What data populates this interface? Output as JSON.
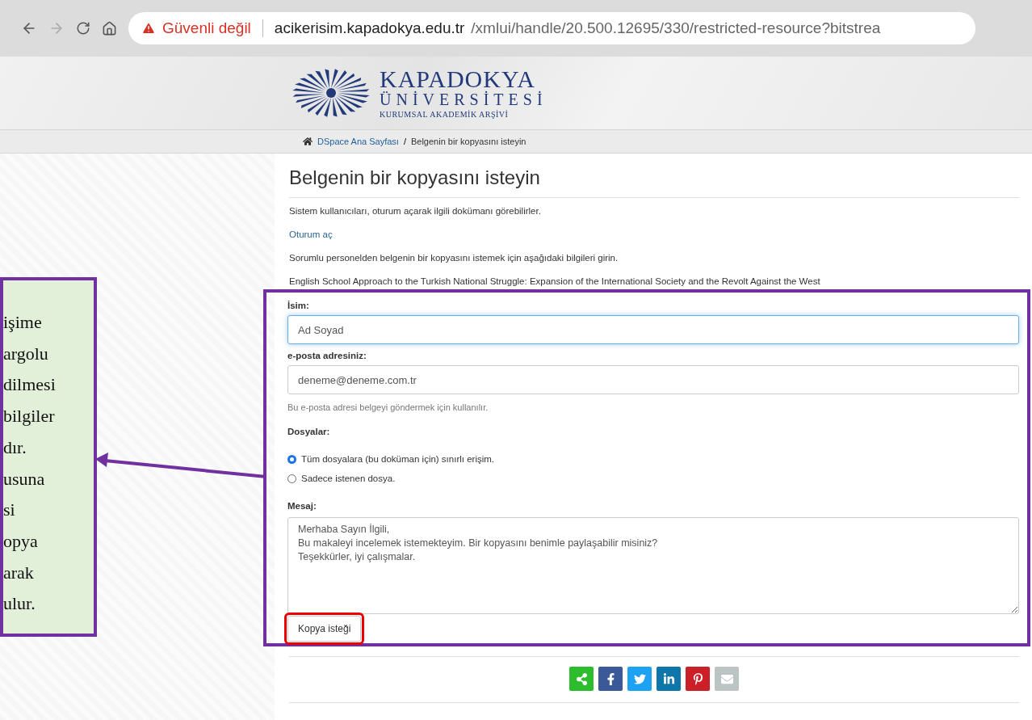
{
  "browser": {
    "security": "Güvenli değil",
    "url_host": "acikerisim.kapadokya.edu.tr",
    "url_path": "/xmlui/handle/20.500.12695/330/restricted-resource?bitstrea"
  },
  "logo": {
    "name": "KAPADOKYA",
    "subtitle": "ÜNİVERSİTESİ",
    "tagline": "KURUMSAL AKADEMİK ARŞİVİ"
  },
  "breadcrumb": [
    {
      "label": "DSpace Ana Sayfası",
      "link": true
    },
    {
      "label": "Belgenin bir kopyasını isteyin",
      "link": false
    }
  ],
  "breadcrumb_separator": "/",
  "page": {
    "title": "Belgenin bir kopyasını isteyin",
    "intro": "Sistem kullanıcıları, oturum açarak ilgili dokümanı görebilirler.",
    "login_link": "Oturum aç",
    "instruction": "Sorumlu personelden belgenin bir kopyasını istemek için aşağıdaki bilgileri girin.",
    "document_title": "English School Approach to the Turkish National Struggle: Expansion of the International Society and the Revolt Against the West"
  },
  "form": {
    "name_label": "İsim:",
    "name_value": "Ad Soyad",
    "email_label": "e-posta adresiniz:",
    "email_value": "deneme@deneme.com.tr",
    "email_help": "Bu e-posta adresi belgeyi göndermek için kullanılır.",
    "files_label": "Dosyalar:",
    "file_options": [
      {
        "label": "Tüm dosyalara (bu doküman için) sınırlı erişim.",
        "selected": true
      },
      {
        "label": "Sadece istenen dosya.",
        "selected": false
      }
    ],
    "message_label": "Mesaj:",
    "message_value": "Merhaba Sayın İlgili,\nBu makaleyi incelemek istemekteyim. Bir kopyasını benimle paylaşabilir misiniz?\nTeşekkürler, iyi çalışmalar.",
    "submit": "Kopya isteği"
  },
  "share_buttons": [
    {
      "kind": "share"
    },
    {
      "kind": "facebook"
    },
    {
      "kind": "twitter"
    },
    {
      "kind": "linkedin"
    },
    {
      "kind": "pinterest"
    },
    {
      "kind": "email"
    }
  ],
  "callout": {
    "lines": [
      "işime",
      "argolu",
      "dilmesi",
      "bilgiler",
      "dır.",
      "usuna",
      "si",
      "opya",
      "arak",
      "ulur."
    ]
  }
}
